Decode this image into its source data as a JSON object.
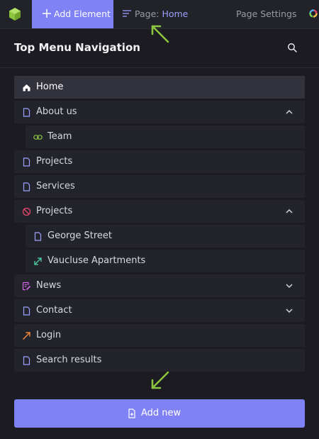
{
  "toolbar": {
    "add_element_label": "Add Element",
    "page_prefix": "Page: ",
    "page_name": "Home",
    "page_settings_label": "Page Settings"
  },
  "panel": {
    "title": "Top Menu Navigation"
  },
  "menu_items": [
    {
      "label": "Home",
      "icon": "home-icon",
      "active": true,
      "level": 0,
      "expandable": false
    },
    {
      "label": "About us",
      "icon": "page-icon",
      "level": 0,
      "expandable": true,
      "expanded": true
    },
    {
      "label": "Team",
      "icon": "link-icon",
      "level": 1,
      "expandable": false
    },
    {
      "label": "Projects",
      "icon": "page-icon",
      "level": 0,
      "expandable": false
    },
    {
      "label": "Services",
      "icon": "page-icon",
      "level": 0,
      "expandable": false
    },
    {
      "label": "Projects",
      "icon": "disabled-icon",
      "level": 0,
      "expandable": true,
      "expanded": true
    },
    {
      "label": "George Street",
      "icon": "page-icon",
      "level": 1,
      "expandable": false
    },
    {
      "label": "Vaucluse Apartments",
      "icon": "external-link-icon",
      "level": 1,
      "expandable": false
    },
    {
      "label": "News",
      "icon": "edit-list-icon",
      "level": 0,
      "expandable": true,
      "expanded": false
    },
    {
      "label": "Contact",
      "icon": "page-icon",
      "level": 0,
      "expandable": true,
      "expanded": false
    },
    {
      "label": "Login",
      "icon": "arrow-up-right-icon",
      "level": 0,
      "expandable": false
    },
    {
      "label": "Search results",
      "icon": "page-icon",
      "level": 0,
      "expandable": false
    }
  ],
  "footer": {
    "add_new_label": "Add new"
  },
  "colors": {
    "accent": "#7e82f5",
    "background": "#1b1b21",
    "item_background": "#23232b",
    "annotation_arrow": "#8cc63f"
  }
}
